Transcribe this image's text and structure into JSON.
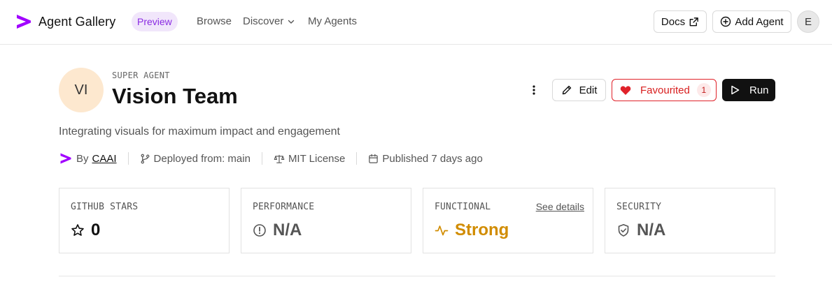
{
  "nav": {
    "brand_title": "Agent Gallery",
    "preview_badge": "Preview",
    "links": [
      "Browse",
      "Discover",
      "My Agents"
    ],
    "docs_label": "Docs",
    "add_agent_label": "Add Agent",
    "avatar_initial": "E"
  },
  "agent": {
    "initials": "VI",
    "eyebrow": "SUPER AGENT",
    "title": "Vision Team",
    "description": "Integrating visuals for maximum impact and engagement",
    "actions": {
      "edit_label": "Edit",
      "favourited_label": "Favourited",
      "favourite_count": "1",
      "run_label": "Run"
    },
    "meta": {
      "by_prefix": "By",
      "by_name": "CAAI",
      "deployed": "Deployed from: main",
      "license": "MIT License",
      "published": "Published 7 days ago"
    }
  },
  "stats": [
    {
      "label": "GITHUB STARS",
      "value": "0",
      "icon": "star-icon"
    },
    {
      "label": "PERFORMANCE",
      "value": "N/A",
      "icon": "alert-circle-icon"
    },
    {
      "label": "FUNCTIONAL",
      "value": "Strong",
      "icon": "activity-icon",
      "link": "See details"
    },
    {
      "label": "SECURITY",
      "value": "N/A",
      "icon": "shield-check-icon"
    }
  ],
  "colors": {
    "brand_purple": "#8a2be2",
    "favourite_red": "#e0222a",
    "functional_gold": "#d18c00",
    "avatar_peach": "#fde8cf"
  }
}
